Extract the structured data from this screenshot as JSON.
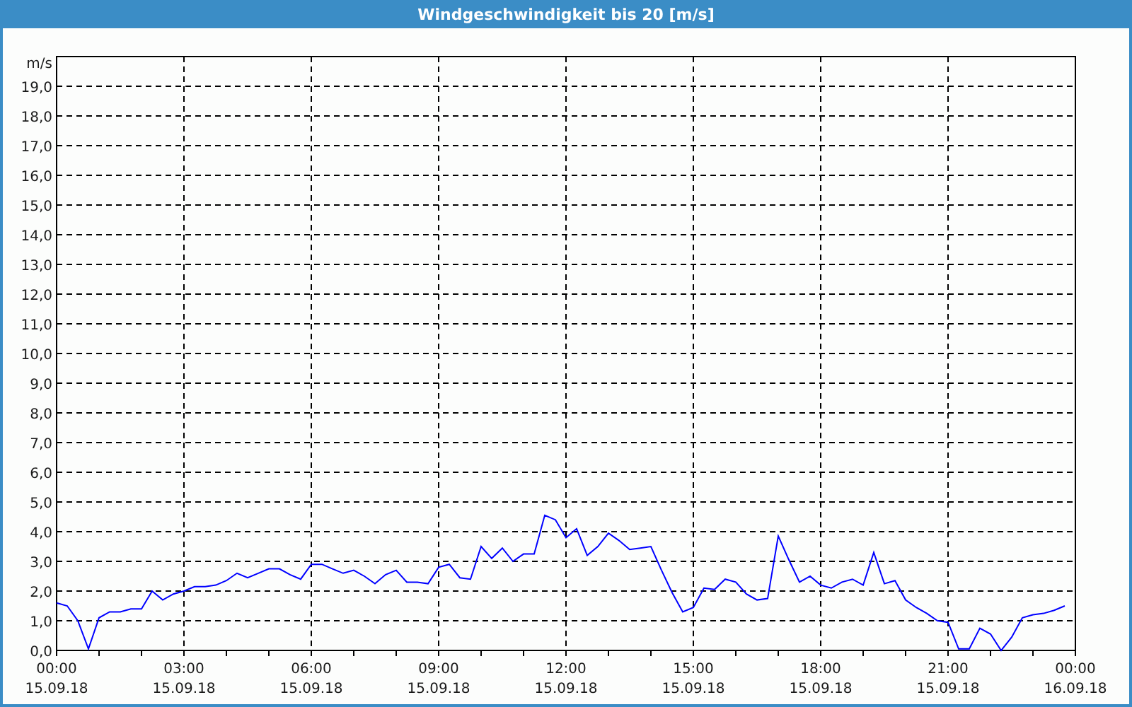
{
  "window": {
    "title": "Windgeschwindigkeit bis 20 [m/s]"
  },
  "chart": {
    "chart_data": {
      "type": "line",
      "grid": true,
      "ylabel": "m/s",
      "ylim": [
        0,
        20
      ],
      "categories": [
        "00:00 15.09.18",
        null,
        null,
        null,
        null,
        null,
        null,
        null,
        null,
        null,
        null,
        null,
        "03:00 15.09.18",
        null,
        null,
        null,
        null,
        null,
        null,
        null,
        null,
        null,
        null,
        null,
        "06:00 15.09.18",
        null,
        null,
        null,
        null,
        null,
        null,
        null,
        null,
        null,
        null,
        null,
        "09:00 15.09.18",
        null,
        null,
        null,
        null,
        null,
        null,
        null,
        null,
        null,
        null,
        null,
        "12:00 15.09.18",
        null,
        null,
        null,
        null,
        null,
        null,
        null,
        null,
        null,
        null,
        null,
        "15:00 15.09.18",
        null,
        null,
        null,
        null,
        null,
        null,
        null,
        null,
        null,
        null,
        null,
        "18:00 15.09.18",
        null,
        null,
        null,
        null,
        null,
        null,
        null,
        null,
        null,
        null,
        null,
        "21:00 15.09.18",
        null,
        null,
        null,
        null,
        null,
        null,
        null,
        null,
        null,
        null,
        null,
        "00:00 16.09.18"
      ],
      "yticks": [
        {
          "value": 0,
          "label": "0,0"
        },
        {
          "value": 1,
          "label": "1,0"
        },
        {
          "value": 2,
          "label": "2,0"
        },
        {
          "value": 3,
          "label": "3,0"
        },
        {
          "value": 4,
          "label": "4,0"
        },
        {
          "value": 5,
          "label": "5,0"
        },
        {
          "value": 6,
          "label": "6,0"
        },
        {
          "value": 7,
          "label": "7,0"
        },
        {
          "value": 8,
          "label": "8,0"
        },
        {
          "value": 9,
          "label": "9,0"
        },
        {
          "value": 10,
          "label": "10,0"
        },
        {
          "value": 11,
          "label": "11,0"
        },
        {
          "value": 12,
          "label": "12,0"
        },
        {
          "value": 13,
          "label": "13,0"
        },
        {
          "value": 14,
          "label": "14,0"
        },
        {
          "value": 15,
          "label": "15,0"
        },
        {
          "value": 16,
          "label": "16,0"
        },
        {
          "value": 17,
          "label": "17,0"
        },
        {
          "value": 18,
          "label": "18,0"
        },
        {
          "value": 19,
          "label": "19,0"
        }
      ],
      "series": [
        {
          "color": "#0000ff",
          "values": [
            1.6,
            1.5,
            1.0,
            0.05,
            1.1,
            1.3,
            1.3,
            1.4,
            1.4,
            2.0,
            1.7,
            1.9,
            2.0,
            2.15,
            2.15,
            2.2,
            2.35,
            2.6,
            2.45,
            2.6,
            2.75,
            2.75,
            2.55,
            2.4,
            2.9,
            2.9,
            2.75,
            2.6,
            2.7,
            2.5,
            2.25,
            2.55,
            2.7,
            2.3,
            2.3,
            2.25,
            2.8,
            2.9,
            2.45,
            2.4,
            3.5,
            3.1,
            3.45,
            3.0,
            3.25,
            3.25,
            4.55,
            4.4,
            3.8,
            4.1,
            3.2,
            3.5,
            3.95,
            3.7,
            3.4,
            3.45,
            3.5,
            2.7,
            1.95,
            1.3,
            1.45,
            2.1,
            2.05,
            2.4,
            2.3,
            1.9,
            1.7,
            1.75,
            3.85,
            3.05,
            2.3,
            2.5,
            2.2,
            2.1,
            2.3,
            2.4,
            2.2,
            3.3,
            2.25,
            2.35,
            1.7,
            1.45,
            1.25,
            1.0,
            0.95,
            0.05,
            0.05,
            0.75,
            0.55,
            0.0,
            0.45,
            1.1,
            1.2,
            1.25,
            1.35,
            1.5,
            null
          ]
        }
      ]
    }
  }
}
